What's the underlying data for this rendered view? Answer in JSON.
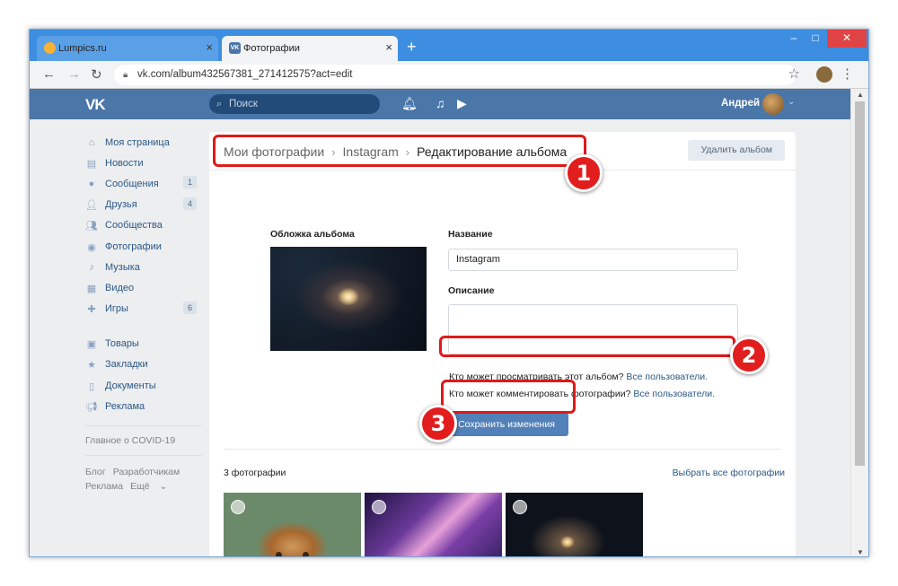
{
  "browser": {
    "tabs": [
      {
        "title": "Lumpics.ru",
        "active": false
      },
      {
        "title": "Фотографии",
        "active": true
      }
    ],
    "url": "vk.com/album432567381_271412575?act=edit",
    "new_tab": "+",
    "minimize": "–",
    "maximize": "□",
    "close": "✕"
  },
  "vk_header": {
    "logo": "VK",
    "search_placeholder": "Поиск",
    "user_name": "Андрей",
    "brand_color": "#4a76a8"
  },
  "sidebar": {
    "items": [
      {
        "label": "Моя страница",
        "icon": "home-icon",
        "count": ""
      },
      {
        "label": "Новости",
        "icon": "news-icon",
        "count": ""
      },
      {
        "label": "Сообщения",
        "icon": "messages-icon",
        "count": "1"
      },
      {
        "label": "Друзья",
        "icon": "friends-icon",
        "count": "4"
      },
      {
        "label": "Сообщества",
        "icon": "communities-icon",
        "count": ""
      },
      {
        "label": "Фотографии",
        "icon": "photos-icon",
        "count": ""
      },
      {
        "label": "Музыка",
        "icon": "music-icon",
        "count": ""
      },
      {
        "label": "Видео",
        "icon": "video-icon",
        "count": ""
      },
      {
        "label": "Игры",
        "icon": "games-icon",
        "count": "6"
      }
    ],
    "items2": [
      {
        "label": "Товары",
        "icon": "goods-icon"
      },
      {
        "label": "Закладки",
        "icon": "bookmarks-icon"
      },
      {
        "label": "Документы",
        "icon": "documents-icon"
      },
      {
        "label": "Реклама",
        "icon": "ads-icon"
      }
    ],
    "covid": "Главное о COVID-19",
    "footer": {
      "blog": "Блог",
      "dev": "Разработчикам",
      "ads": "Реклама",
      "more": "Ещё"
    }
  },
  "main": {
    "breadcrumb": {
      "root": "Мои фотографии",
      "album": "Instagram",
      "current": "Редактирование альбома"
    },
    "delete_album": "Удалить альбом",
    "cover_label": "Обложка альбома",
    "name_label": "Название",
    "name_value": "Instagram",
    "desc_label": "Описание",
    "desc_value": "",
    "view_privacy": {
      "text": "Кто может просматривать этот альбом?",
      "value": "Все пользователи."
    },
    "comment_privacy": {
      "text": "Кто может комментировать фотографии?",
      "value": "Все пользователи."
    },
    "save_button": "Сохранить изменения",
    "photos_count": "3 фотографии",
    "select_all": "Выбрать все фотографии"
  },
  "annotations": {
    "n1": "1",
    "n2": "2",
    "n3": "3",
    "color": "#e01919"
  }
}
